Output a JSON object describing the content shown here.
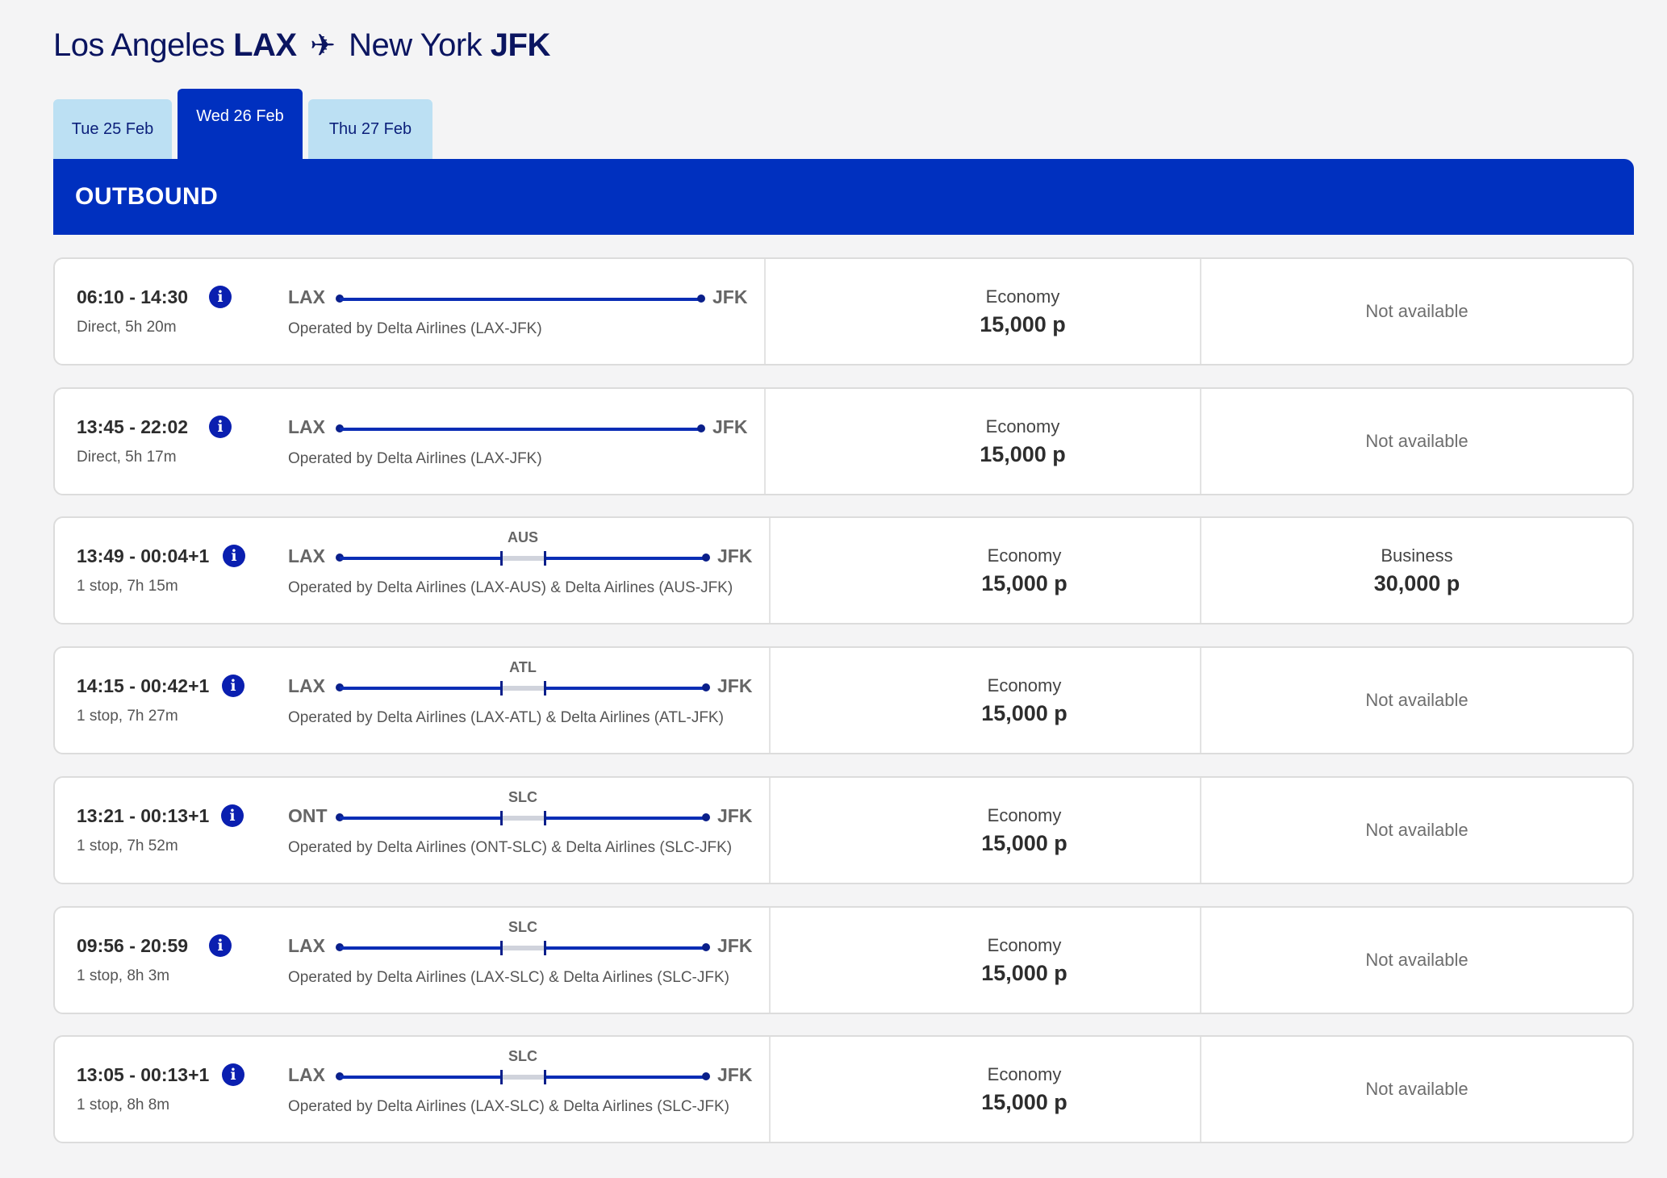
{
  "header": {
    "origin_city": "Los Angeles",
    "origin_code": "LAX",
    "plane_icon": "airplane-icon",
    "destination_city": "New York",
    "destination_code": "JFK"
  },
  "tabs": [
    {
      "label": "Tue 25 Feb",
      "active": false
    },
    {
      "label": "Wed 26 Feb",
      "active": true
    },
    {
      "label": "Thu 27 Feb",
      "active": false
    }
  ],
  "section_title": "OUTBOUND",
  "colors": {
    "brand_blue": "#0030bf",
    "tab_inactive": "#bce0f3",
    "title_navy": "#0b1560",
    "route_line": "#0a2db5"
  },
  "flights": [
    {
      "time": "06:10 - 14:30",
      "duration": "Direct, 5h 20m",
      "from": "LAX",
      "to": "JFK",
      "stop": null,
      "operated": "Operated by Delta Airlines (LAX-JFK)",
      "economy": {
        "cabin": "Economy",
        "price": "15,000 p"
      },
      "business": {
        "available": false,
        "text": "Not available"
      }
    },
    {
      "time": "13:45 - 22:02",
      "duration": "Direct, 5h 17m",
      "from": "LAX",
      "to": "JFK",
      "stop": null,
      "operated": "Operated by Delta Airlines (LAX-JFK)",
      "economy": {
        "cabin": "Economy",
        "price": "15,000 p"
      },
      "business": {
        "available": false,
        "text": "Not available"
      }
    },
    {
      "time": "13:49 - 00:04+1",
      "duration": "1 stop, 7h 15m",
      "from": "LAX",
      "to": "JFK",
      "stop": "AUS",
      "operated": "Operated by Delta Airlines (LAX-AUS) & Delta Airlines (AUS-JFK)",
      "economy": {
        "cabin": "Economy",
        "price": "15,000 p"
      },
      "business": {
        "available": true,
        "cabin": "Business",
        "price": "30,000 p"
      }
    },
    {
      "time": "14:15 - 00:42+1",
      "duration": "1 stop, 7h 27m",
      "from": "LAX",
      "to": "JFK",
      "stop": "ATL",
      "operated": "Operated by Delta Airlines (LAX-ATL) & Delta Airlines (ATL-JFK)",
      "economy": {
        "cabin": "Economy",
        "price": "15,000 p"
      },
      "business": {
        "available": false,
        "text": "Not available"
      }
    },
    {
      "time": "13:21 - 00:13+1",
      "duration": "1 stop, 7h 52m",
      "from": "ONT",
      "to": "JFK",
      "stop": "SLC",
      "operated": "Operated by Delta Airlines (ONT-SLC) & Delta Airlines (SLC-JFK)",
      "economy": {
        "cabin": "Economy",
        "price": "15,000 p"
      },
      "business": {
        "available": false,
        "text": "Not available"
      }
    },
    {
      "time": "09:56 - 20:59",
      "duration": "1 stop, 8h 3m",
      "from": "LAX",
      "to": "JFK",
      "stop": "SLC",
      "operated": "Operated by Delta Airlines (LAX-SLC) & Delta Airlines (SLC-JFK)",
      "economy": {
        "cabin": "Economy",
        "price": "15,000 p"
      },
      "business": {
        "available": false,
        "text": "Not available"
      }
    },
    {
      "time": "13:05 - 00:13+1",
      "duration": "1 stop, 8h 8m",
      "from": "LAX",
      "to": "JFK",
      "stop": "SLC",
      "operated": "Operated by Delta Airlines (LAX-SLC) & Delta Airlines (SLC-JFK)",
      "economy": {
        "cabin": "Economy",
        "price": "15,000 p"
      },
      "business": {
        "available": false,
        "text": "Not available"
      }
    }
  ]
}
